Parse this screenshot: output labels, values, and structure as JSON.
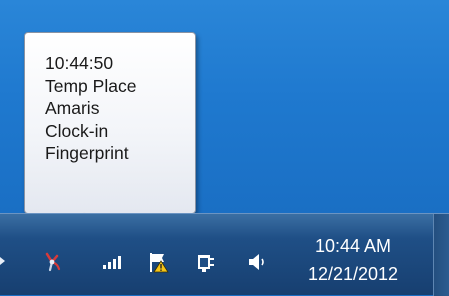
{
  "tooltip": {
    "lines": [
      "10:44:50",
      "Temp Place",
      "Amaris",
      "Clock-in",
      "Fingerprint"
    ]
  },
  "taskbar": {
    "clock": {
      "time": "10:44 AM",
      "date": "12/21/2012"
    },
    "tray_icons": [
      "fingerprint-app-icon",
      "network-signal-icon",
      "action-center-flag-icon",
      "power-plug-icon",
      "volume-speaker-icon"
    ]
  },
  "colors": {
    "desktop": "#1f79cf",
    "taskbar": "#1f4f86",
    "tooltip_bg": "#f3f5f9",
    "tooltip_text": "#1a1a1a",
    "clock_text": "#ffffff"
  }
}
